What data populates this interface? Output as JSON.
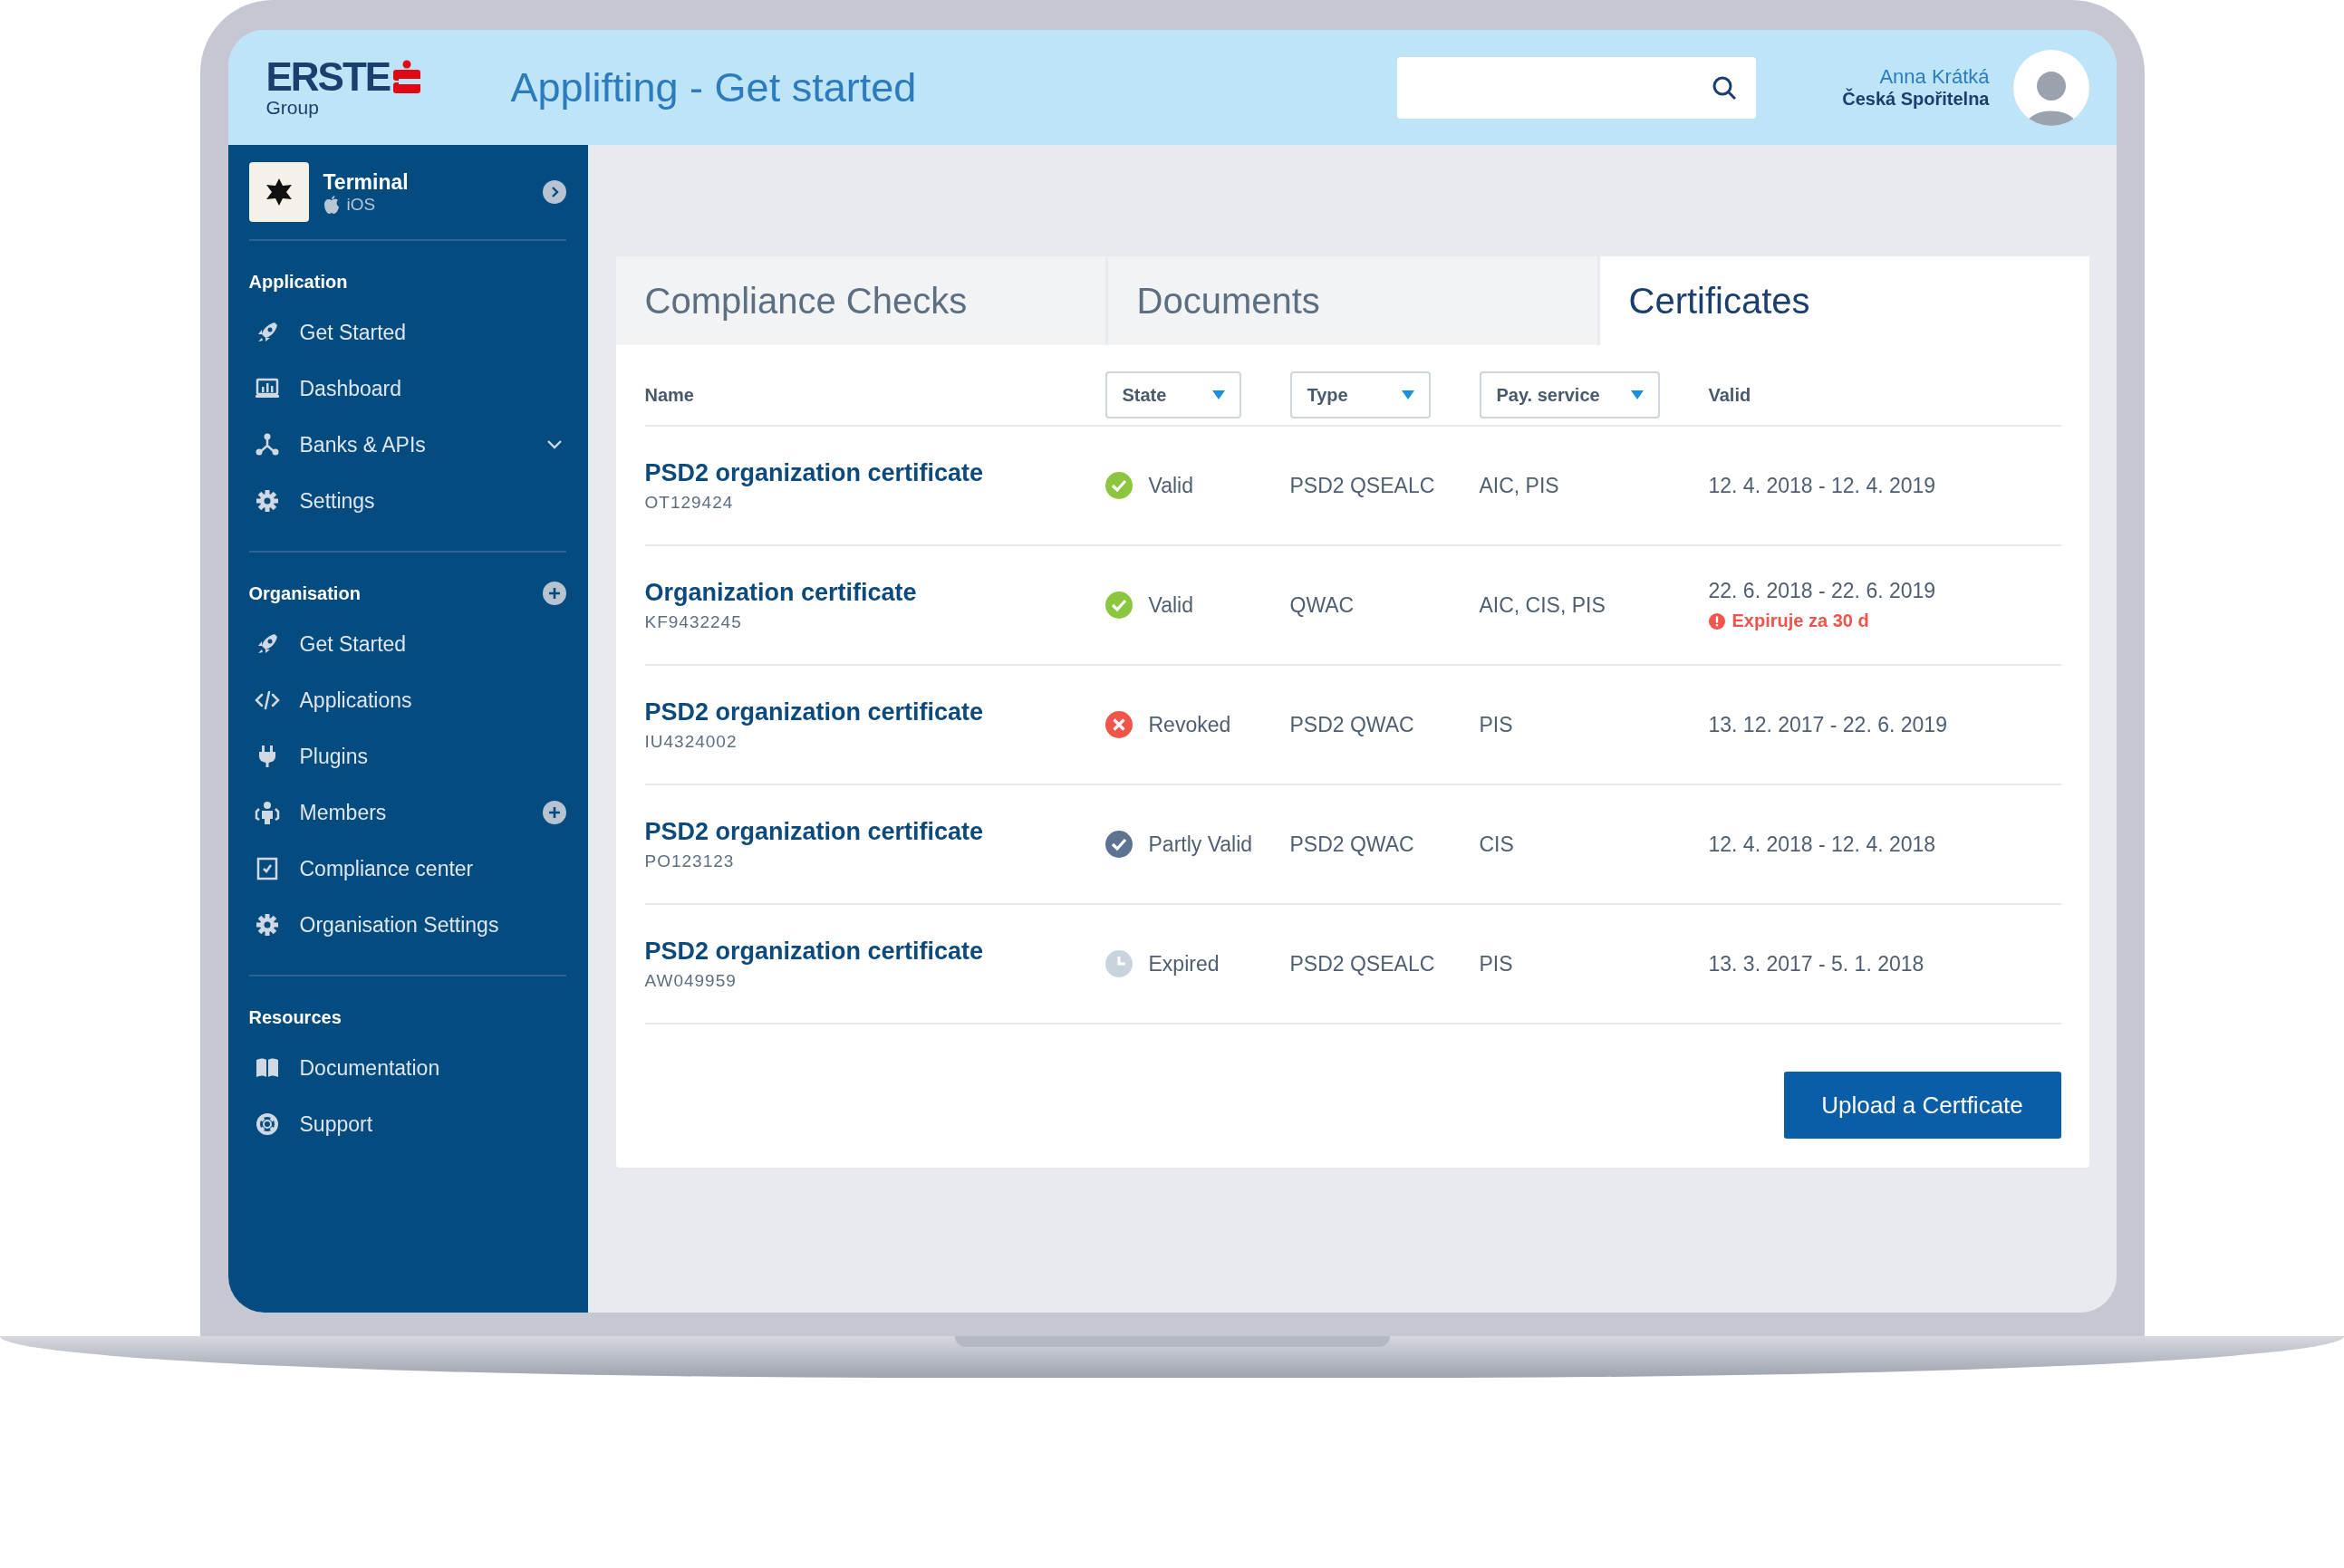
{
  "header": {
    "logo": {
      "name": "ERSTE",
      "sub": "Group"
    },
    "title": "Applifting - Get started",
    "user": {
      "name": "Anna Krátká",
      "org": "Česká Spořitelna"
    }
  },
  "sidebar": {
    "app": {
      "name": "Terminal",
      "platform": "iOS"
    },
    "sections": [
      {
        "title": "Application",
        "addable": false,
        "items": [
          {
            "label": "Get Started",
            "addable": false
          },
          {
            "label": "Dashboard",
            "addable": false
          },
          {
            "label": "Banks & APIs",
            "addable": false,
            "expanded": false
          },
          {
            "label": "Settings",
            "addable": false
          }
        ]
      },
      {
        "title": "Organisation",
        "addable": true,
        "items": [
          {
            "label": "Get Started",
            "addable": false
          },
          {
            "label": "Applications",
            "addable": false
          },
          {
            "label": "Plugins",
            "addable": false
          },
          {
            "label": "Members",
            "addable": true
          },
          {
            "label": "Compliance center",
            "addable": false
          },
          {
            "label": "Organisation Settings",
            "addable": false
          }
        ]
      },
      {
        "title": "Resources",
        "addable": false,
        "items": [
          {
            "label": "Documentation",
            "addable": false
          },
          {
            "label": "Support",
            "addable": false
          }
        ]
      }
    ]
  },
  "tabs": [
    {
      "label": "Compliance Checks",
      "selected": false
    },
    {
      "label": "Documents",
      "selected": false
    },
    {
      "label": "Certificates",
      "selected": true
    }
  ],
  "table": {
    "columns": [
      {
        "label": "Name",
        "filter": false
      },
      {
        "label": "State",
        "filter": true
      },
      {
        "label": "Type",
        "filter": true
      },
      {
        "label": "Pay. service",
        "filter": true
      },
      {
        "label": "Valid",
        "filter": false
      }
    ],
    "rows": [
      {
        "name": "PSD2 organization certificate",
        "id": "OT129424",
        "state": {
          "label": "Valid",
          "kind": "valid"
        },
        "type": "PSD2 QSEALC",
        "service": "AIC, PIS",
        "valid": "12. 4. 2018 - 12. 4. 2019"
      },
      {
        "name": "Organization certificate",
        "id": "KF9432245",
        "state": {
          "label": "Valid",
          "kind": "valid"
        },
        "type": "QWAC",
        "service": "AIC, CIS, PIS",
        "valid": "22. 6. 2018 - 22. 6. 2019",
        "warning": "Expiruje za 30 d"
      },
      {
        "name": "PSD2 organization certificate",
        "id": "IU4324002",
        "state": {
          "label": "Revoked",
          "kind": "revoked"
        },
        "type": "PSD2 QWAC",
        "service": "PIS",
        "valid": "13. 12. 2017 - 22. 6. 2019"
      },
      {
        "name": "PSD2 organization certificate",
        "id": "PO123123",
        "state": {
          "label": "Partly Valid",
          "kind": "partly"
        },
        "type": "PSD2 QWAC",
        "service": "CIS",
        "valid": "12. 4. 2018 - 12. 4. 2018"
      },
      {
        "name": "PSD2 organization certificate",
        "id": "AW049959",
        "state": {
          "label": "Expired",
          "kind": "expired"
        },
        "type": "PSD2 QSEALC",
        "service": "PIS",
        "valid": "13. 3. 2017 - 5. 1. 2018"
      }
    ]
  },
  "upload_button": "Upload a Certficate"
}
